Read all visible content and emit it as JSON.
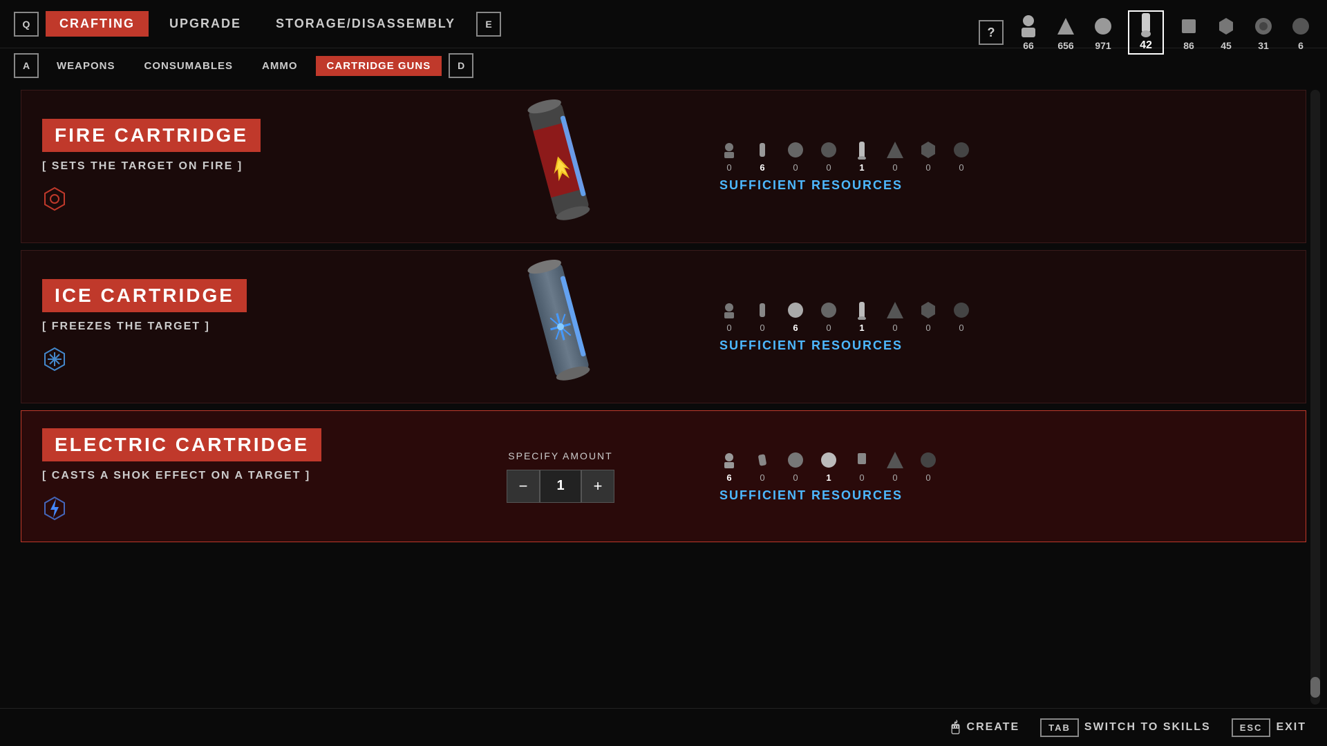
{
  "nav": {
    "left_key": "Q",
    "right_key": "E",
    "tabs": [
      {
        "label": "CRAFTING",
        "active": true
      },
      {
        "label": "UPGRADE",
        "active": false
      },
      {
        "label": "STORAGE/DISASSEMBLY",
        "active": false
      }
    ]
  },
  "sub_nav": {
    "left_key": "A",
    "right_key": "D",
    "tabs": [
      {
        "label": "WEAPONS",
        "active": false
      },
      {
        "label": "CONSUMABLES",
        "active": false
      },
      {
        "label": "AMMO",
        "active": false
      },
      {
        "label": "CARTRIDGE GUNS",
        "active": true
      }
    ]
  },
  "resources_bar": {
    "help": "?",
    "items": [
      {
        "count": "66",
        "highlighted": false
      },
      {
        "count": "656",
        "highlighted": false
      },
      {
        "count": "971",
        "highlighted": false
      },
      {
        "count": "42",
        "highlighted": true
      },
      {
        "count": "86",
        "highlighted": false
      },
      {
        "count": "45",
        "highlighted": false
      },
      {
        "count": "31",
        "highlighted": false
      },
      {
        "count": "6",
        "highlighted": false
      }
    ]
  },
  "cards": [
    {
      "id": "fire-cartridge",
      "name": "FIRE CARTRIDGE",
      "description": "[ SETS THE TARGET ON FIRE ]",
      "selected": false,
      "resources": [
        {
          "count": "0"
        },
        {
          "count": "6",
          "needed": true
        },
        {
          "count": "0"
        },
        {
          "count": "0"
        },
        {
          "count": "1",
          "needed": true
        },
        {
          "count": "0"
        },
        {
          "count": "0"
        },
        {
          "count": "0"
        }
      ],
      "status": "SUFFICIENT RESOURCES"
    },
    {
      "id": "ice-cartridge",
      "name": "ICE CARTRIDGE",
      "description": "[ FREEZES THE TARGET ]",
      "selected": false,
      "resources": [
        {
          "count": "0"
        },
        {
          "count": "0"
        },
        {
          "count": "6",
          "needed": true
        },
        {
          "count": "0"
        },
        {
          "count": "1",
          "needed": true
        },
        {
          "count": "0"
        },
        {
          "count": "0"
        },
        {
          "count": "0"
        }
      ],
      "status": "SUFFICIENT RESOURCES"
    },
    {
      "id": "electric-cartridge",
      "name": "ELECTRIC CARTRIDGE",
      "description": "[ CASTS A SHOK EFFECT ON A TARGET ]",
      "selected": true,
      "specify_label": "SPECIFY AMOUNT",
      "amount": "1",
      "resources": [
        {
          "count": "6",
          "needed": true
        },
        {
          "count": "0"
        },
        {
          "count": "0"
        },
        {
          "count": "1",
          "needed": true
        },
        {
          "count": "0"
        },
        {
          "count": "0"
        },
        {
          "count": "0"
        }
      ],
      "status": "SUFFICIENT RESOURCES"
    }
  ],
  "bottom_bar": {
    "create_icon": "🖱",
    "create_label": "CREATE",
    "tab_key": "TAB",
    "switch_label": "SWITCH TO SKILLS",
    "esc_key": "ESC",
    "exit_label": "EXIT"
  }
}
